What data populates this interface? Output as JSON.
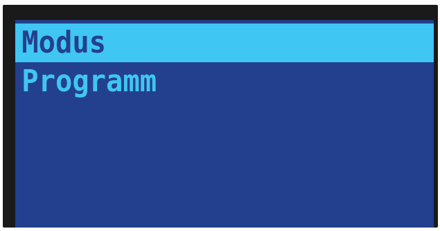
{
  "display": {
    "menu": {
      "items": [
        {
          "label": "Modus",
          "selected": true
        },
        {
          "label": "Programm",
          "selected": false
        }
      ]
    }
  },
  "colors": {
    "screen_background": "#23408e",
    "highlight": "#3fc6f3",
    "bezel": "#1a1a1a"
  }
}
